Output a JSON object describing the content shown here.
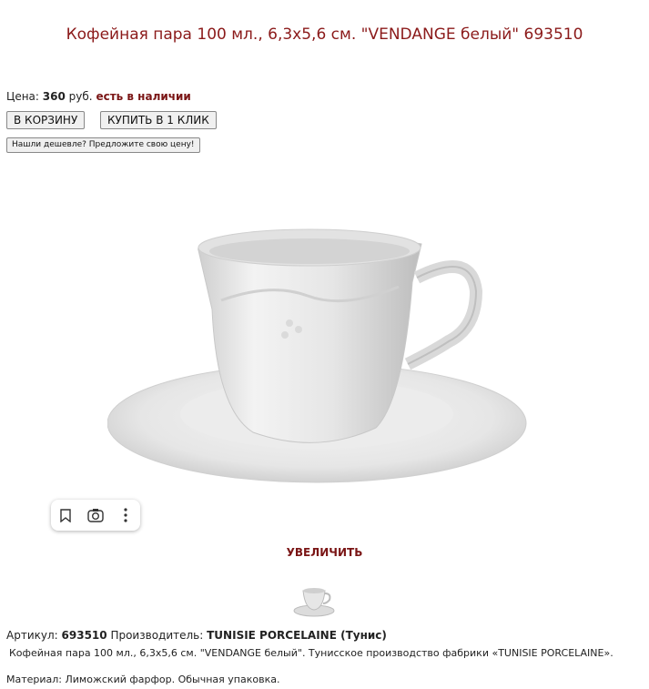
{
  "product": {
    "title": "Кофейная пара 100 мл., 6,3х5,6 см. \"VENDANGE белый\" 693510"
  },
  "price": {
    "label": "Цена:",
    "value": "360",
    "currency": "руб.",
    "stock": "есть в наличии"
  },
  "buttons": {
    "cart": "В КОРЗИНУ",
    "one_click": "КУПИТЬ В 1 КЛИК",
    "cheaper": "Нашли дешевле? Предложите свою цену!"
  },
  "image_toolbar": {
    "icons": [
      "bookmark-icon",
      "lens-search-icon",
      "more-vertical-icon"
    ]
  },
  "zoom_link": "УВЕЛИЧИТЬ",
  "details": {
    "article_label": "Артикул:",
    "article": "693510",
    "maker_label": "Производитель:",
    "maker": "TUNISIE PORCELAINE (Тунис)",
    "description": "Кофейная пара 100 мл., 6,3х5,6 см. \"VENDANGE белый\". Тунисское производство фабрики «TUNISIE PORCELAINE».",
    "material": "Материал: Лиможский фарфор. Обычная упаковка."
  },
  "colors": {
    "title": "#8b1a1a",
    "accent": "#7a1515"
  }
}
